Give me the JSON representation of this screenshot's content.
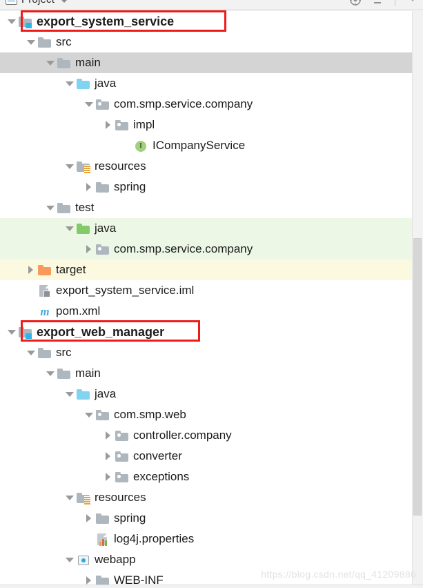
{
  "toolbar": {
    "panel_title": "Project",
    "project_icon": "project-icon",
    "icons": [
      "locate-icon",
      "collapse-all-icon",
      "settings-dropdown-icon"
    ]
  },
  "scrollbar": {
    "orientation": "vertical"
  },
  "watermark": "https://blog.csdn.net/qq_41209886",
  "annotations": [
    {
      "name": "highlight-export-system-service",
      "color": "#ee1c18"
    },
    {
      "name": "highlight-export-web-manager",
      "color": "#ee1c18"
    }
  ],
  "tree": {
    "rows": [
      {
        "label": "export_system_service",
        "indent": 0,
        "toggle": "down",
        "icon": "module-folder-icon",
        "bold": true,
        "state": "none"
      },
      {
        "label": "src",
        "indent": 1,
        "toggle": "down",
        "icon": "folder-icon",
        "bold": false,
        "state": "none"
      },
      {
        "label": "main",
        "indent": 2,
        "toggle": "down",
        "icon": "folder-icon",
        "bold": false,
        "state": "selected"
      },
      {
        "label": "java",
        "indent": 3,
        "toggle": "down",
        "icon": "source-folder-icon",
        "bold": false,
        "state": "none"
      },
      {
        "label": "com.smp.service.company",
        "indent": 4,
        "toggle": "down",
        "icon": "package-icon",
        "bold": false,
        "state": "none"
      },
      {
        "label": "impl",
        "indent": 5,
        "toggle": "right",
        "icon": "package-icon",
        "bold": false,
        "state": "none"
      },
      {
        "label": "ICompanyService",
        "indent": 6,
        "toggle": "none",
        "icon": "interface-icon",
        "bold": false,
        "state": "none"
      },
      {
        "label": "resources",
        "indent": 3,
        "toggle": "down",
        "icon": "resources-folder-icon",
        "bold": false,
        "state": "none"
      },
      {
        "label": "spring",
        "indent": 4,
        "toggle": "right",
        "icon": "folder-icon",
        "bold": false,
        "state": "none"
      },
      {
        "label": "test",
        "indent": 2,
        "toggle": "down",
        "icon": "folder-icon",
        "bold": false,
        "state": "none"
      },
      {
        "label": "java",
        "indent": 3,
        "toggle": "down",
        "icon": "test-source-folder-icon",
        "bold": false,
        "state": "tint-green"
      },
      {
        "label": "com.smp.service.company",
        "indent": 4,
        "toggle": "right",
        "icon": "package-icon",
        "bold": false,
        "state": "tint-green"
      },
      {
        "label": "target",
        "indent": 1,
        "toggle": "right",
        "icon": "excluded-folder-icon",
        "bold": false,
        "state": "tint-yellow"
      },
      {
        "label": "export_system_service.iml",
        "indent": 1,
        "toggle": "none",
        "icon": "iml-file-icon",
        "bold": false,
        "state": "none"
      },
      {
        "label": "pom.xml",
        "indent": 1,
        "toggle": "none",
        "icon": "maven-file-icon",
        "bold": false,
        "state": "none"
      },
      {
        "label": "export_web_manager",
        "indent": 0,
        "toggle": "down",
        "icon": "module-folder-icon",
        "bold": true,
        "state": "none"
      },
      {
        "label": "src",
        "indent": 1,
        "toggle": "down",
        "icon": "folder-icon",
        "bold": false,
        "state": "none"
      },
      {
        "label": "main",
        "indent": 2,
        "toggle": "down",
        "icon": "folder-icon",
        "bold": false,
        "state": "none"
      },
      {
        "label": "java",
        "indent": 3,
        "toggle": "down",
        "icon": "source-folder-icon",
        "bold": false,
        "state": "none"
      },
      {
        "label": "com.smp.web",
        "indent": 4,
        "toggle": "down",
        "icon": "package-icon",
        "bold": false,
        "state": "none"
      },
      {
        "label": "controller.company",
        "indent": 5,
        "toggle": "right",
        "icon": "package-icon",
        "bold": false,
        "state": "none"
      },
      {
        "label": "converter",
        "indent": 5,
        "toggle": "right",
        "icon": "package-icon",
        "bold": false,
        "state": "none"
      },
      {
        "label": "exceptions",
        "indent": 5,
        "toggle": "right",
        "icon": "package-icon",
        "bold": false,
        "state": "none"
      },
      {
        "label": "resources",
        "indent": 3,
        "toggle": "down",
        "icon": "resources-folder-icon",
        "bold": false,
        "state": "none"
      },
      {
        "label": "spring",
        "indent": 4,
        "toggle": "right",
        "icon": "folder-icon",
        "bold": false,
        "state": "none"
      },
      {
        "label": "log4j.properties",
        "indent": 4,
        "toggle": "none",
        "icon": "properties-file-icon",
        "bold": false,
        "state": "none"
      },
      {
        "label": "webapp",
        "indent": 3,
        "toggle": "down",
        "icon": "webapp-icon",
        "bold": false,
        "state": "none"
      },
      {
        "label": "WEB-INF",
        "indent": 4,
        "toggle": "right",
        "icon": "folder-icon",
        "bold": false,
        "state": "none"
      }
    ]
  }
}
